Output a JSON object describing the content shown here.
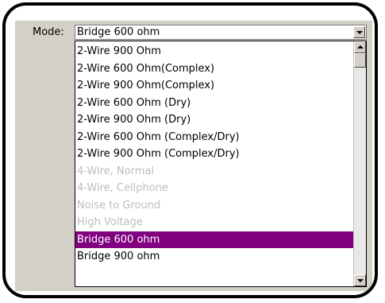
{
  "mode_label": "Mode:",
  "mode_select": {
    "selected_value": "Bridge 600 ohm"
  },
  "dropdown": {
    "items": [
      {
        "label": "2-Wire 900 Ohm",
        "state": "enabled"
      },
      {
        "label": "2-Wire 600 Ohm(Complex)",
        "state": "enabled"
      },
      {
        "label": "2-Wire 900 Ohm(Complex)",
        "state": "enabled"
      },
      {
        "label": "2-Wire 600 Ohm (Dry)",
        "state": "enabled"
      },
      {
        "label": "2-Wire 900 Ohm (Dry)",
        "state": "enabled"
      },
      {
        "label": "2-Wire 600 Ohm (Complex/Dry)",
        "state": "enabled"
      },
      {
        "label": "2-Wire 900 Ohm (Complex/Dry)",
        "state": "enabled"
      },
      {
        "label": "4-Wire, Normal",
        "state": "disabled"
      },
      {
        "label": "4-Wire, Cellphone",
        "state": "disabled"
      },
      {
        "label": "Noise to Ground",
        "state": "disabled"
      },
      {
        "label": "High Voltage",
        "state": "disabled"
      },
      {
        "label": "Bridge 600 ohm",
        "state": "selected"
      },
      {
        "label": "Bridge 900 ohm",
        "state": "enabled"
      }
    ],
    "selected_color": "#800080",
    "disabled_color": "#bdbdbd"
  },
  "icons": {
    "combo_arrow": "chevron-down-icon",
    "scroll_up": "arrow-up-icon",
    "scroll_down": "arrow-down-icon"
  }
}
